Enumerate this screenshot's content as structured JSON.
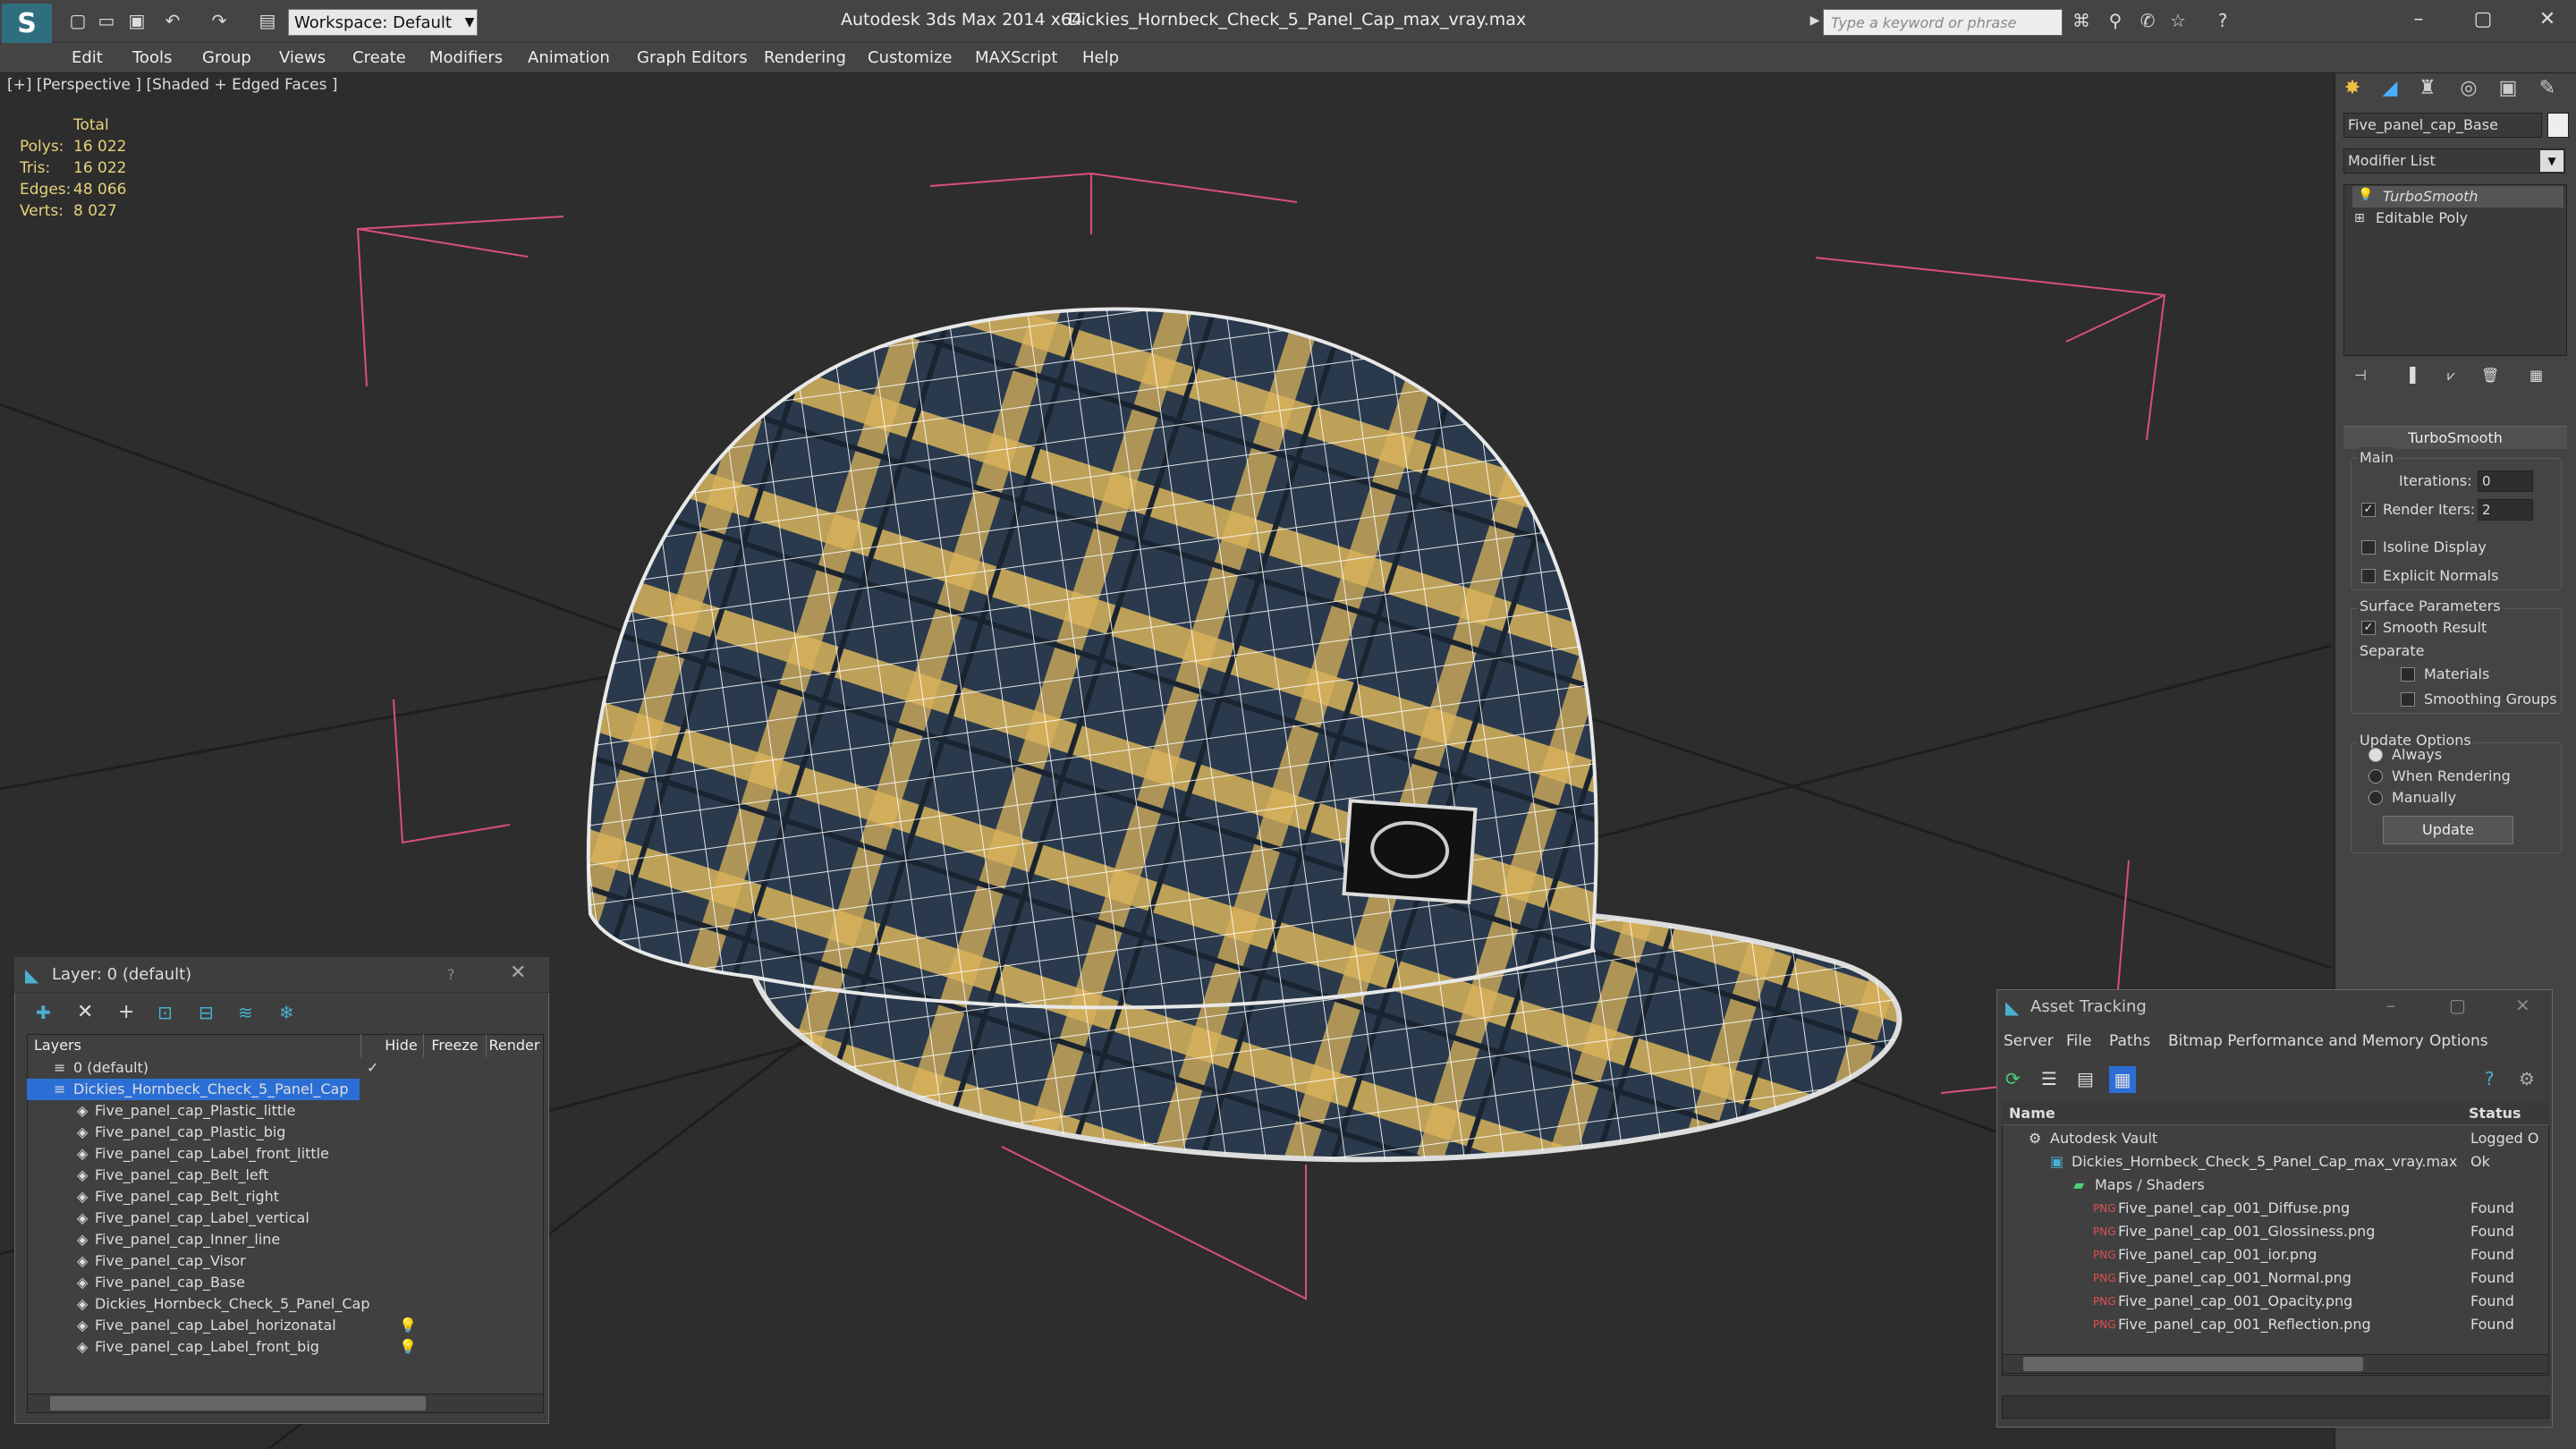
{
  "titlebar": {
    "app_title": "Autodesk 3ds Max  2014 x64",
    "file_title": "Dickies_Hornbeck_Check_5_Panel_Cap_max_vray.max",
    "workspace": "Workspace: Default",
    "search_placeholder": "Type a keyword or phrase"
  },
  "menu": [
    "Edit",
    "Tools",
    "Group",
    "Views",
    "Create",
    "Modifiers",
    "Animation",
    "Graph Editors",
    "Rendering",
    "Customize",
    "MAXScript",
    "Help"
  ],
  "viewport": {
    "label": "[+] [Perspective ] [Shaded + Edged Faces ]",
    "stats_header": "Total",
    "stats": [
      {
        "label": "Polys:",
        "value": "16 022"
      },
      {
        "label": "Tris:",
        "value": "16 022"
      },
      {
        "label": "Edges:",
        "value": "48 066"
      },
      {
        "label": "Verts:",
        "value": "8 027"
      }
    ]
  },
  "command_panel": {
    "object_name": "Five_panel_cap_Base",
    "modifier_list": "Modifier List",
    "stack": [
      "TurboSmooth",
      "Editable Poly"
    ],
    "rollout": "TurboSmooth",
    "main_group": "Main",
    "iterations_label": "Iterations:",
    "iterations_value": "0",
    "render_iters_label": "Render Iters:",
    "render_iters_value": "2",
    "isoline": "Isoline Display",
    "explicit_normals": "Explicit Normals",
    "surface_group": "Surface Parameters",
    "smooth_result": "Smooth Result",
    "separate": "Separate",
    "materials": "Materials",
    "smoothing_groups": "Smoothing Groups",
    "update_group": "Update Options",
    "always": "Always",
    "when_rendering": "When Rendering",
    "manually": "Manually",
    "update_button": "Update"
  },
  "layer_panel": {
    "title": "Layer: 0 (default)",
    "help": "?",
    "columns": [
      "Layers",
      "Hide",
      "Freeze",
      "Render"
    ],
    "layers": [
      "0 (default)",
      "Dickies_Hornbeck_Check_5_Panel_Cap",
      "Five_panel_cap_Plastic_little",
      "Five_panel_cap_Plastic_big",
      "Five_panel_cap_Label_front_little",
      "Five_panel_cap_Belt_left",
      "Five_panel_cap_Belt_right",
      "Five_panel_cap_Label_vertical",
      "Five_panel_cap_Inner_line",
      "Five_panel_cap_Visor",
      "Five_panel_cap_Base",
      "Dickies_Hornbeck_Check_5_Panel_Cap",
      "Five_panel_cap_Label_horizonatal",
      "Five_panel_cap_Label_front_big"
    ]
  },
  "asset_tracking": {
    "title": "Asset Tracking",
    "menu": [
      "Server",
      "File",
      "Paths",
      "Bitmap Performance and Memory",
      "Options"
    ],
    "columns": [
      "Name",
      "Status"
    ],
    "rows": [
      {
        "name": "Autodesk Vault",
        "status": "Logged O"
      },
      {
        "name": "Dickies_Hornbeck_Check_5_Panel_Cap_max_vray.max",
        "status": "Ok"
      },
      {
        "name": "Maps / Shaders",
        "status": ""
      },
      {
        "name": "Five_panel_cap_001_Diffuse.png",
        "status": "Found"
      },
      {
        "name": "Five_panel_cap_001_Glossiness.png",
        "status": "Found"
      },
      {
        "name": "Five_panel_cap_001_ior.png",
        "status": "Found"
      },
      {
        "name": "Five_panel_cap_001_Normal.png",
        "status": "Found"
      },
      {
        "name": "Five_panel_cap_001_Opacity.png",
        "status": "Found"
      },
      {
        "name": "Five_panel_cap_001_Reflection.png",
        "status": "Found"
      }
    ]
  },
  "colors": {
    "accent": "#2b6fd6",
    "stats": "#e6d27a",
    "cap_navy": "#2a3a4c",
    "cap_gold": "#d9b35a"
  }
}
